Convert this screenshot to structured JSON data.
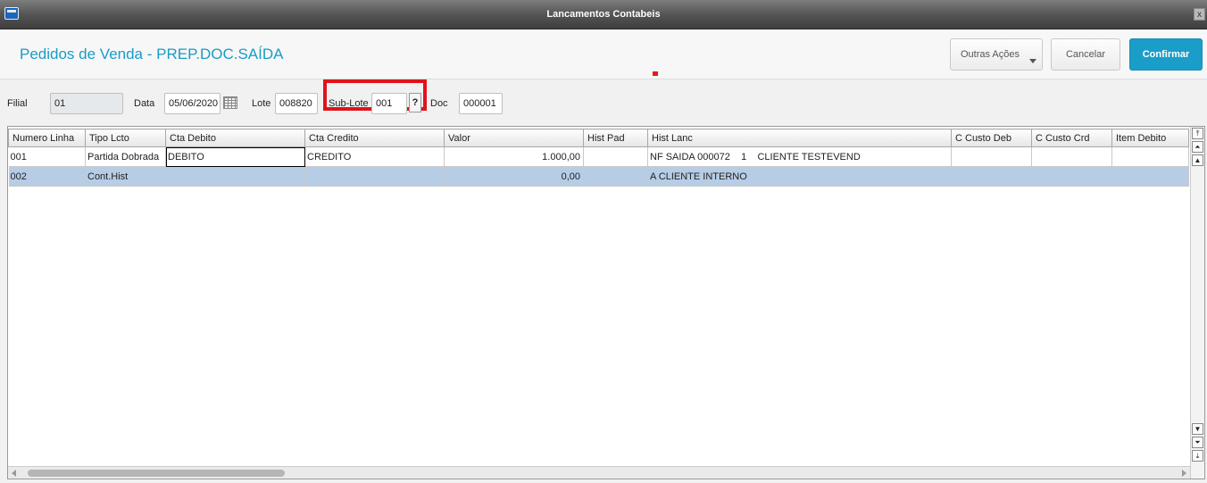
{
  "window": {
    "title": "Lancamentos Contabeis",
    "close_label": "x"
  },
  "header": {
    "page_title": "Pedidos de Venda - PREP.DOC.SAÍDA",
    "outras_acoes_label": "Outras Ações",
    "cancelar_label": "Cancelar",
    "confirmar_label": "Confirmar"
  },
  "form": {
    "filial_label": "Filial",
    "filial_value": "01",
    "data_label": "Data",
    "data_value": "05/06/2020",
    "lote_label": "Lote",
    "lote_value": "008820",
    "sublote_label": "Sub-Lote",
    "sublote_value": "001",
    "lookup_label": "?",
    "doc_label": "Doc",
    "doc_value": "000001"
  },
  "grid": {
    "columns": [
      "Numero Linha",
      "Tipo Lcto",
      "Cta Debito",
      "Cta Credito",
      "Valor",
      "Hist Pad",
      "Hist Lanc",
      "C Custo Deb",
      "C Custo Crd",
      "Item Debito"
    ],
    "rows": [
      [
        "001",
        "Partida Dobrada",
        "DEBITO",
        "CREDITO",
        "1.000,00",
        "",
        "NF SAIDA 000072    1    CLIENTE TESTEVEND",
        "",
        "",
        ""
      ],
      [
        "002",
        "Cont.Hist",
        "",
        "",
        "0,00",
        "",
        "A CLIENTE INTERNO",
        "",
        "",
        ""
      ]
    ],
    "selected_row": 1,
    "focused_cell": "0.2"
  },
  "colors": {
    "accent": "#1a9bc6",
    "confirm": "#1a9ec9",
    "highlight": "#e0131c",
    "selected_row": "#b7cde6"
  },
  "icons": [
    "app-icon",
    "calendar-icon",
    "close-icon",
    "chevron-down-icon",
    "scroll-arrow-icons"
  ]
}
